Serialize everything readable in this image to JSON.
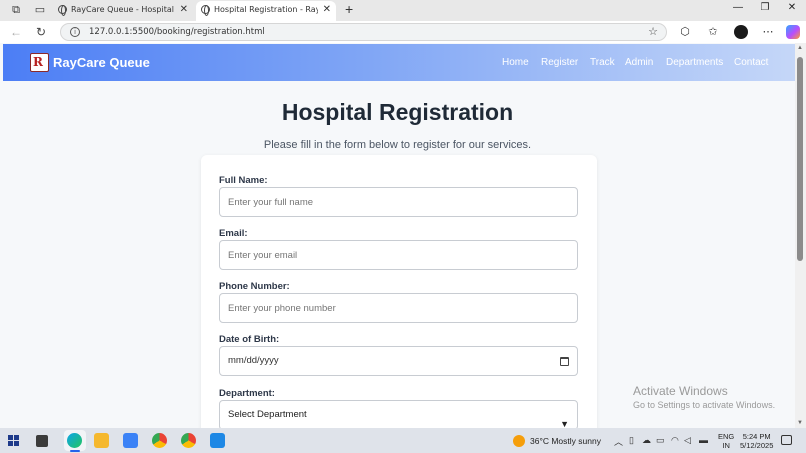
{
  "browser": {
    "tabs": [
      {
        "label": "RayCare Queue - Hospital Queue",
        "active": false
      },
      {
        "label": "Hospital Registration - RayCare Queue",
        "active": true
      }
    ],
    "url": "127.0.0.1:5500/booking/registration.html"
  },
  "site": {
    "brand": "RayCare Queue",
    "logo_letter": "R",
    "nav": [
      "Home",
      "Register",
      "Track",
      "Admin",
      "Departments",
      "Contact"
    ]
  },
  "page": {
    "title": "Hospital Registration",
    "subtitle": "Please fill in the form below to register for our services."
  },
  "form": {
    "full_name": {
      "label": "Full Name:",
      "placeholder": "Enter your full name"
    },
    "email": {
      "label": "Email:",
      "placeholder": "Enter your email"
    },
    "phone": {
      "label": "Phone Number:",
      "placeholder": "Enter your phone number"
    },
    "dob": {
      "label": "Date of Birth:",
      "value": "mm/dd/yyyy"
    },
    "department": {
      "label": "Department:",
      "selected": "Select Department"
    }
  },
  "watermark": {
    "line1": "Activate Windows",
    "line2": "Go to Settings to activate Windows."
  },
  "taskbar": {
    "weather": "36°C  Mostly sunny",
    "lang_line1": "ENG",
    "lang_line2": "IN",
    "time": "5:24 PM",
    "date": "5/12/2025"
  },
  "colors": {
    "navbar_start": "#4c7ef5",
    "navbar_end": "#c5d7f8",
    "title_text": "#1f2a37"
  }
}
